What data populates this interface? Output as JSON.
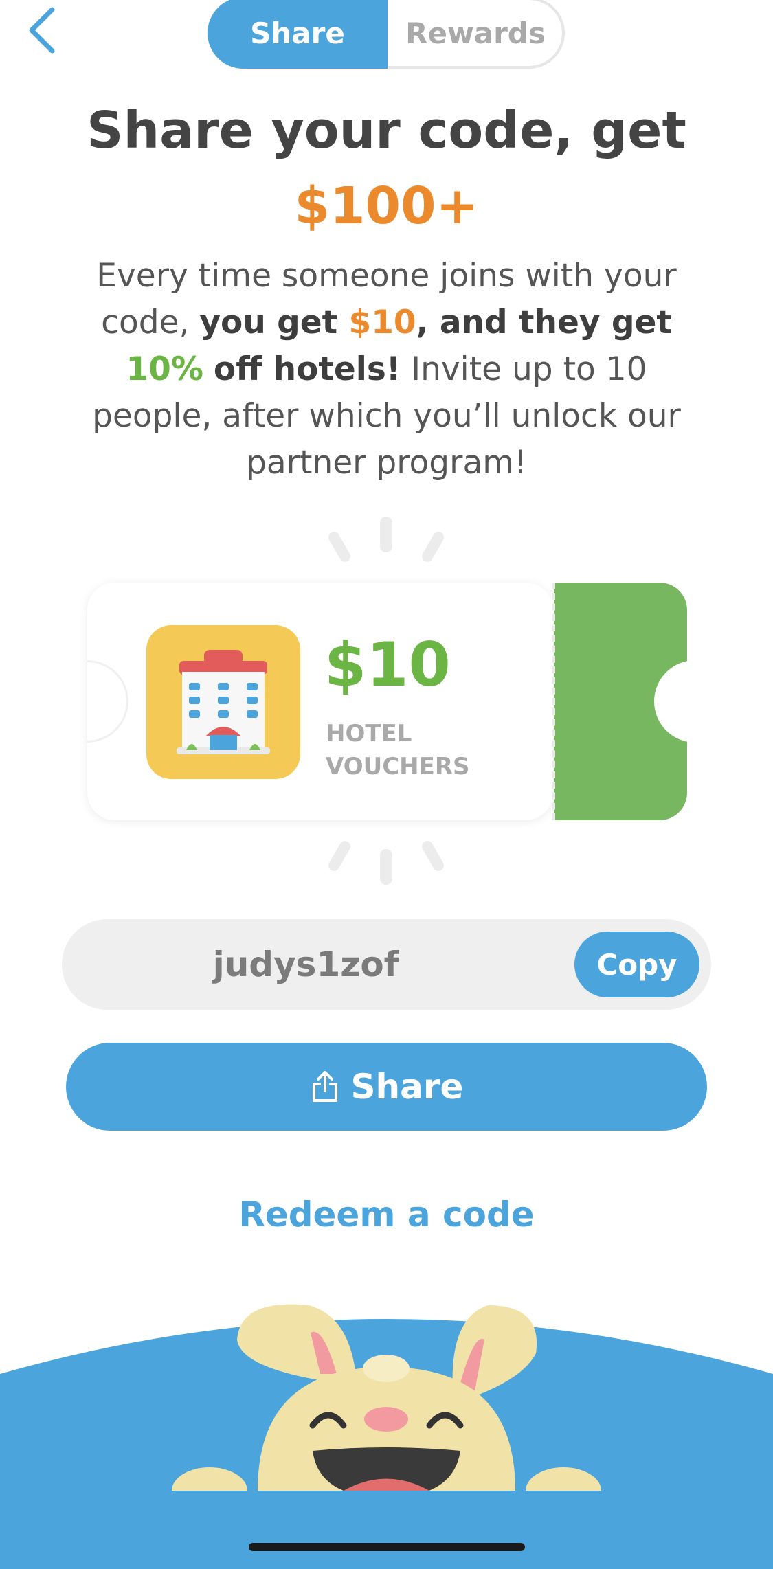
{
  "header": {
    "tabs": [
      {
        "label": "Share",
        "active": true
      },
      {
        "label": "Rewards",
        "active": false
      }
    ]
  },
  "hero": {
    "title": "Share your code, get",
    "amount": "$100+",
    "description": {
      "p1": "Every time someone joins with your code, ",
      "b1": "you get ",
      "orange": "$10",
      "b2": ", and they get ",
      "green": "10%",
      "b3": "off hotels!",
      "p2": " Invite up to 10 people, after which you’ll unlock our partner program!"
    }
  },
  "voucher": {
    "value": "$10",
    "label": "HOTEL VOUCHERS",
    "icon": "hotel-icon"
  },
  "referral": {
    "code": "judys1zof",
    "copy_label": "Copy"
  },
  "actions": {
    "share_label": "Share",
    "redeem_label": "Redeem a code"
  },
  "colors": {
    "accent": "#4ba4dc",
    "orange": "#ea8a2c",
    "green": "#6bb544",
    "ticket_green": "#77b760"
  }
}
